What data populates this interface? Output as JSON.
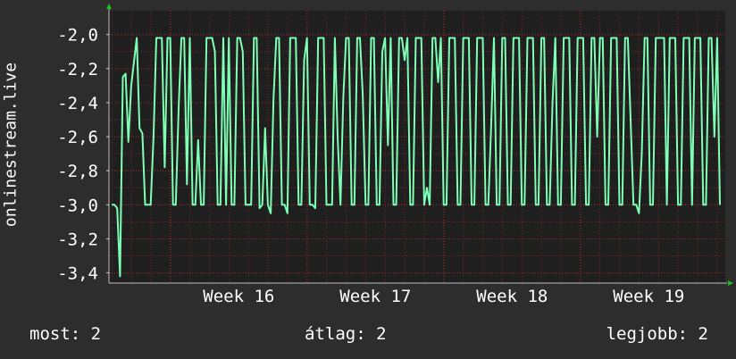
{
  "chart_data": {
    "type": "line",
    "title": "",
    "ylabel": "onlinestream.live",
    "xlabel": "",
    "y_ticks": [
      -2.0,
      -2.2,
      -2.4,
      -2.6,
      -2.8,
      -3.0,
      -3.2,
      -3.4
    ],
    "y_tick_labels": [
      "-2,0",
      "-2,2",
      "-2,4",
      "-2,6",
      "-2,8",
      "-3,0",
      "-3,2",
      "-3,4"
    ],
    "ylim": [
      -3.46,
      -1.86
    ],
    "x_tick_labels": [
      "Week 16",
      "Week 17",
      "Week 18",
      "Week 19"
    ],
    "x_range_weeks": [
      15.55,
      20.06
    ],
    "grid": true,
    "colors": {
      "background": "#2d2d2d",
      "plot_background": "#1f1f1f",
      "line": "#7dffb5",
      "grid": "#8a2a2a",
      "axis_arrow": "#18c418"
    },
    "series": [
      {
        "values": [
          -3.0,
          -3.0,
          -3.02,
          -3.42,
          -2.25,
          -2.23,
          -2.63,
          -2.3,
          -2.16,
          -2.02,
          -2.55,
          -2.58,
          -3.0,
          -3.0,
          -3.0,
          -2.6,
          -2.02,
          -2.02,
          -2.02,
          -2.78,
          -2.02,
          -2.02,
          -3.0,
          -3.0,
          -2.43,
          -2.02,
          -2.02,
          -2.88,
          -2.02,
          -3.0,
          -3.0,
          -2.62,
          -3.0,
          -3.0,
          -2.02,
          -2.02,
          -2.02,
          -2.1,
          -3.0,
          -3.0,
          -2.02,
          -3.0,
          -2.02,
          -3.0,
          -3.0,
          -2.02,
          -2.02,
          -2.1,
          -3.0,
          -3.0,
          -3.0,
          -2.02,
          -2.02,
          -3.02,
          -3.0,
          -2.55,
          -3.0,
          -3.05,
          -2.38,
          -2.02,
          -2.02,
          -3.0,
          -3.0,
          -3.05,
          -2.02,
          -2.02,
          -2.02,
          -3.0,
          -3.0,
          -2.15,
          -2.02,
          -3.0,
          -3.0,
          -3.02,
          -2.02,
          -2.02,
          -2.02,
          -3.0,
          -3.0,
          -3.0,
          -2.02,
          -2.6,
          -3.0,
          -2.38,
          -2.02,
          -2.02,
          -3.0,
          -3.0,
          -2.02,
          -2.02,
          -2.35,
          -3.0,
          -3.0,
          -2.02,
          -2.02,
          -3.0,
          -3.0,
          -2.1,
          -2.02,
          -2.65,
          -2.02,
          -3.0,
          -3.0,
          -2.02,
          -2.02,
          -2.15,
          -2.02,
          -3.0,
          -3.0,
          -2.02,
          -2.02,
          -2.02,
          -3.0,
          -2.9,
          -3.0,
          -2.02,
          -2.02,
          -2.28,
          -2.02,
          -3.0,
          -3.0,
          -2.02,
          -2.02,
          -2.02,
          -3.0,
          -3.0,
          -2.02,
          -2.02,
          -2.02,
          -3.0,
          -3.0,
          -2.02,
          -2.02,
          -2.02,
          -3.0,
          -3.0,
          -2.55,
          -2.02,
          -3.0,
          -3.0,
          -2.02,
          -2.02,
          -3.0,
          -3.0,
          -2.02,
          -2.02,
          -2.02,
          -3.0,
          -3.0,
          -2.02,
          -2.02,
          -2.02,
          -3.0,
          -3.0,
          -2.02,
          -2.02,
          -3.0,
          -3.0,
          -2.4,
          -2.02,
          -3.0,
          -3.0,
          -2.02,
          -2.02,
          -2.02,
          -3.0,
          -3.0,
          -2.02,
          -2.02,
          -2.02,
          -3.0,
          -3.0,
          -2.02,
          -2.02,
          -2.6,
          -2.02,
          -2.02,
          -3.0,
          -3.0,
          -2.02,
          -2.02,
          -2.02,
          -3.0,
          -3.0,
          -2.02,
          -2.02,
          -2.5,
          -3.0,
          -3.0,
          -3.05,
          -2.7,
          -2.02,
          -2.02,
          -3.0,
          -3.0,
          -2.02,
          -2.02,
          -2.02,
          -2.02,
          -3.0,
          -2.02,
          -2.02,
          -2.02,
          -3.0,
          -3.0,
          -2.02,
          -2.02,
          -2.02,
          -3.0,
          -2.02,
          -2.02,
          -2.02,
          -3.0,
          -3.0,
          -2.02,
          -2.02,
          -2.6,
          -2.02,
          -3.0
        ]
      }
    ]
  },
  "footer": {
    "now": "most: 2",
    "avg": "átlag: 2",
    "best": "legjobb: 2"
  }
}
